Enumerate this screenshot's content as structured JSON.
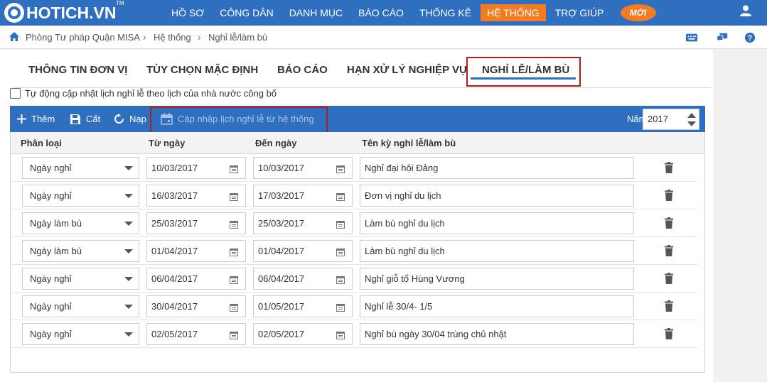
{
  "app": {
    "logo_text": "HOTICH.VN",
    "logo_tm": "TM",
    "nav": [
      {
        "label": "HỒ SƠ",
        "active": false
      },
      {
        "label": "CÔNG DÂN",
        "active": false
      },
      {
        "label": "DANH MỤC",
        "active": false
      },
      {
        "label": "BÁO CÁO",
        "active": false
      },
      {
        "label": "THỐNG KÊ",
        "active": false
      },
      {
        "label": "HỆ THỐNG",
        "active": true
      },
      {
        "label": "TRỢ GIÚP",
        "active": false
      }
    ],
    "new_badge": "MỚI",
    "colors": {
      "primary": "#2f6fc0",
      "accent": "#f47b20",
      "highlight": "#b01c1c"
    }
  },
  "breadcrumb": {
    "items": [
      "Phòng Tư pháp Quận MISA",
      "Hệ thống",
      "Nghỉ lễ/làm bù"
    ]
  },
  "tabs": [
    {
      "label": "THÔNG TIN ĐƠN VỊ",
      "active": false
    },
    {
      "label": "TÙY CHỌN MẶC ĐỊNH",
      "active": false
    },
    {
      "label": "BÁO CÁO",
      "active": false
    },
    {
      "label": "HẠN XỬ LÝ NGHIỆP VỤ",
      "active": false
    },
    {
      "label": "NGHỈ LỄ/LÀM BÙ",
      "active": true
    }
  ],
  "auto_update": {
    "checked": false,
    "label": "Tự động cập nhật lịch nghỉ lễ theo lịch của nhà nước công bố"
  },
  "toolbar": {
    "add_label": "Thêm",
    "save_label": "Cất",
    "reload_label": "Nạp",
    "update_label": "Cập nhập lịch nghỉ lễ từ hệ thống",
    "year_label": "Năm",
    "year_value": "2017"
  },
  "grid": {
    "headers": {
      "type": "Phân loại",
      "from": "Từ ngày",
      "to": "Đến ngày",
      "name": "Tên kỳ nghỉ lễ/làm bù"
    },
    "rows": [
      {
        "type": "Ngày nghỉ",
        "from": "10/03/2017",
        "to": "10/03/2017",
        "name": "Nghỉ đại hội Đảng"
      },
      {
        "type": "Ngày nghỉ",
        "from": "16/03/2017",
        "to": "17/03/2017",
        "name": "Đơn vị nghỉ du lịch"
      },
      {
        "type": "Ngày làm bù",
        "from": "25/03/2017",
        "to": "25/03/2017",
        "name": "Làm bù nghỉ du lịch"
      },
      {
        "type": "Ngày làm bù",
        "from": "01/04/2017",
        "to": "01/04/2017",
        "name": "Làm bù nghỉ du lịch"
      },
      {
        "type": "Ngày nghỉ",
        "from": "06/04/2017",
        "to": "06/04/2017",
        "name": "Nghỉ giỗ tổ Hùng Vương"
      },
      {
        "type": "Ngày nghỉ",
        "from": "30/04/2017",
        "to": "01/05/2017",
        "name": "Nghỉ lễ 30/4- 1/5"
      },
      {
        "type": "Ngày nghỉ",
        "from": "02/05/2017",
        "to": "02/05/2017",
        "name": "Nghỉ bù ngày 30/04 trùng chủ nhật"
      }
    ]
  }
}
